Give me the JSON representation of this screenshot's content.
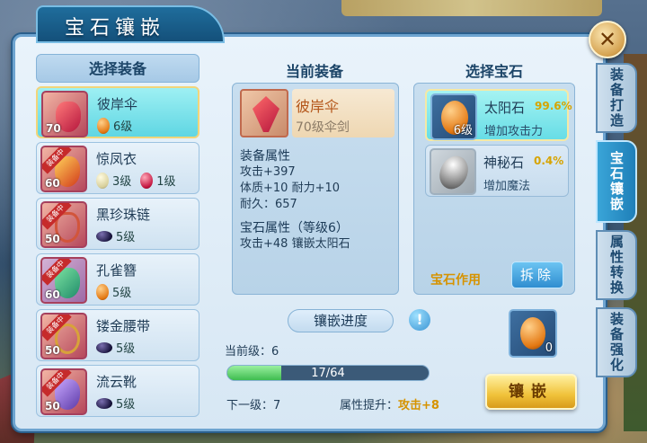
{
  "window": {
    "title": "宝石镶嵌"
  },
  "side_tabs": [
    "装备打造",
    "宝石镶嵌",
    "属性转换",
    "装备强化"
  ],
  "left": {
    "header": "选择装备",
    "items": [
      {
        "name": "彼岸伞",
        "level": "70",
        "gems": [
          {
            "type": "orange",
            "text": "6级"
          }
        ],
        "ribbon": ""
      },
      {
        "name": "惊凤衣",
        "level": "60",
        "gems": [
          {
            "type": "white",
            "text": "3级"
          },
          {
            "type": "red",
            "text": "1级"
          }
        ],
        "ribbon": "装备中"
      },
      {
        "name": "黑珍珠链",
        "level": "50",
        "gems": [
          {
            "type": "dark",
            "text": "5级"
          }
        ],
        "ribbon": "装备中"
      },
      {
        "name": "孔雀簪",
        "level": "60",
        "gems": [
          {
            "type": "orange",
            "text": "5级"
          }
        ],
        "ribbon": "装备中"
      },
      {
        "name": "镂金腰带",
        "level": "50",
        "gems": [
          {
            "type": "dark",
            "text": "5级"
          }
        ],
        "ribbon": "装备中"
      },
      {
        "name": "流云靴",
        "level": "50",
        "gems": [
          {
            "type": "dark",
            "text": "5级"
          }
        ],
        "ribbon": "装备中"
      }
    ]
  },
  "middle": {
    "header": "当前装备",
    "name": "彼岸伞",
    "sub": "70级伞剑",
    "equip_attr_title": "装备属性",
    "equip_attrs": [
      "攻击+397",
      "体质+10 耐力+10",
      "耐久：657"
    ],
    "gem_attr_title": "宝石属性（等级6）",
    "gem_attrs": [
      "攻击+48 镶嵌太阳石"
    ]
  },
  "right": {
    "header": "选择宝石",
    "stones": [
      {
        "name": "太阳石",
        "pct": "99.6%",
        "desc": "增加攻击力",
        "count": "6级"
      },
      {
        "name": "神秘石",
        "pct": "0.4%",
        "desc": "增加魔法",
        "count": ""
      }
    ],
    "effect_label": "宝石作用",
    "remove_label": "拆除"
  },
  "progress": {
    "label": "镶嵌进度",
    "current_level": "当前级：6",
    "value": 17,
    "max": 64,
    "text": "17/64",
    "next_level": "下一级：7",
    "attr_up_label": "属性提升：",
    "attr_up_value": "攻击+8"
  },
  "slot": {
    "count": "0"
  },
  "inlay_label": "镶嵌",
  "info_icon": "!",
  "close_icon": "✕"
}
